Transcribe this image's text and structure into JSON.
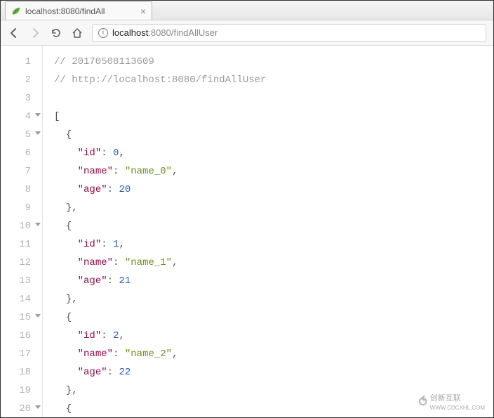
{
  "browser": {
    "tab": {
      "title": "localhost:8080/findAll",
      "favicon_color": "#6db33f"
    },
    "url_host": "localhost",
    "url_portpath": ":8080/findAllUser"
  },
  "code": {
    "lines": [
      {
        "n": 1,
        "fold": false,
        "tokens": [
          {
            "t": "comment",
            "v": "// 20170508113609"
          }
        ]
      },
      {
        "n": 2,
        "fold": false,
        "tokens": [
          {
            "t": "comment",
            "v": "// http://localhost:8080/findAllUser"
          }
        ]
      },
      {
        "n": 3,
        "fold": false,
        "tokens": []
      },
      {
        "n": 4,
        "fold": true,
        "tokens": [
          {
            "t": "punc",
            "v": "["
          }
        ]
      },
      {
        "n": 5,
        "fold": true,
        "tokens": [
          {
            "t": "indent",
            "v": "  "
          },
          {
            "t": "punc",
            "v": "{"
          }
        ]
      },
      {
        "n": 6,
        "fold": false,
        "tokens": [
          {
            "t": "indent",
            "v": "    "
          },
          {
            "t": "key",
            "v": "\"id\""
          },
          {
            "t": "punc",
            "v": ": "
          },
          {
            "t": "num",
            "v": "0"
          },
          {
            "t": "punc",
            "v": ","
          }
        ]
      },
      {
        "n": 7,
        "fold": false,
        "tokens": [
          {
            "t": "indent",
            "v": "    "
          },
          {
            "t": "key",
            "v": "\"name\""
          },
          {
            "t": "punc",
            "v": ": "
          },
          {
            "t": "str",
            "v": "\"name_0\""
          },
          {
            "t": "punc",
            "v": ","
          }
        ]
      },
      {
        "n": 8,
        "fold": false,
        "tokens": [
          {
            "t": "indent",
            "v": "    "
          },
          {
            "t": "key",
            "v": "\"age\""
          },
          {
            "t": "punc",
            "v": ": "
          },
          {
            "t": "num",
            "v": "20"
          }
        ]
      },
      {
        "n": 9,
        "fold": false,
        "tokens": [
          {
            "t": "indent",
            "v": "  "
          },
          {
            "t": "punc",
            "v": "},"
          }
        ]
      },
      {
        "n": 10,
        "fold": true,
        "tokens": [
          {
            "t": "indent",
            "v": "  "
          },
          {
            "t": "punc",
            "v": "{"
          }
        ]
      },
      {
        "n": 11,
        "fold": false,
        "tokens": [
          {
            "t": "indent",
            "v": "    "
          },
          {
            "t": "key",
            "v": "\"id\""
          },
          {
            "t": "punc",
            "v": ": "
          },
          {
            "t": "num",
            "v": "1"
          },
          {
            "t": "punc",
            "v": ","
          }
        ]
      },
      {
        "n": 12,
        "fold": false,
        "tokens": [
          {
            "t": "indent",
            "v": "    "
          },
          {
            "t": "key",
            "v": "\"name\""
          },
          {
            "t": "punc",
            "v": ": "
          },
          {
            "t": "str",
            "v": "\"name_1\""
          },
          {
            "t": "punc",
            "v": ","
          }
        ]
      },
      {
        "n": 13,
        "fold": false,
        "tokens": [
          {
            "t": "indent",
            "v": "    "
          },
          {
            "t": "key",
            "v": "\"age\""
          },
          {
            "t": "punc",
            "v": ": "
          },
          {
            "t": "num",
            "v": "21"
          }
        ]
      },
      {
        "n": 14,
        "fold": false,
        "tokens": [
          {
            "t": "indent",
            "v": "  "
          },
          {
            "t": "punc",
            "v": "},"
          }
        ]
      },
      {
        "n": 15,
        "fold": true,
        "tokens": [
          {
            "t": "indent",
            "v": "  "
          },
          {
            "t": "punc",
            "v": "{"
          }
        ]
      },
      {
        "n": 16,
        "fold": false,
        "tokens": [
          {
            "t": "indent",
            "v": "    "
          },
          {
            "t": "key",
            "v": "\"id\""
          },
          {
            "t": "punc",
            "v": ": "
          },
          {
            "t": "num",
            "v": "2"
          },
          {
            "t": "punc",
            "v": ","
          }
        ]
      },
      {
        "n": 17,
        "fold": false,
        "tokens": [
          {
            "t": "indent",
            "v": "    "
          },
          {
            "t": "key",
            "v": "\"name\""
          },
          {
            "t": "punc",
            "v": ": "
          },
          {
            "t": "str",
            "v": "\"name_2\""
          },
          {
            "t": "punc",
            "v": ","
          }
        ]
      },
      {
        "n": 18,
        "fold": false,
        "tokens": [
          {
            "t": "indent",
            "v": "    "
          },
          {
            "t": "key",
            "v": "\"age\""
          },
          {
            "t": "punc",
            "v": ": "
          },
          {
            "t": "num",
            "v": "22"
          }
        ]
      },
      {
        "n": 19,
        "fold": false,
        "tokens": [
          {
            "t": "indent",
            "v": "  "
          },
          {
            "t": "punc",
            "v": "},"
          }
        ]
      },
      {
        "n": 20,
        "fold": true,
        "tokens": [
          {
            "t": "indent",
            "v": "  "
          },
          {
            "t": "punc",
            "v": "{"
          }
        ]
      }
    ]
  },
  "watermark": {
    "brand_cn": "创新互联",
    "brand_url": "WWW.CDCXHL.COM"
  }
}
